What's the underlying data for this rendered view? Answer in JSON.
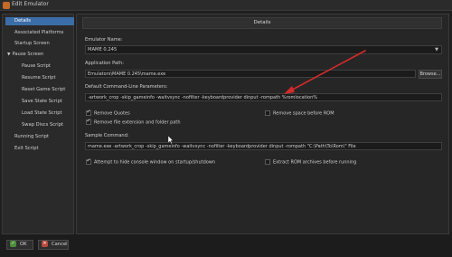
{
  "window": {
    "title": "Edit Emulator"
  },
  "sidebar": {
    "items": [
      {
        "label": "Details",
        "selected": true
      },
      {
        "label": "Associated Platforms"
      },
      {
        "label": "Startup Screen"
      },
      {
        "label": "Pause Screen",
        "expanded": true
      },
      {
        "label": "Pause Script"
      },
      {
        "label": "Resume Script"
      },
      {
        "label": "Reset Game Script"
      },
      {
        "label": "Save State Script"
      },
      {
        "label": "Load State Script"
      },
      {
        "label": "Swap Discs Script"
      },
      {
        "label": "Running Script"
      },
      {
        "label": "Exit Script"
      }
    ]
  },
  "panel": {
    "header": "Details",
    "emulator_name": {
      "label": "Emulator Name:",
      "value": "MAME 0.245"
    },
    "application_path": {
      "label": "Application Path:",
      "value": "Emulators\\MAME 0.245\\mame.exe",
      "browse_label": "Browse..."
    },
    "command_line": {
      "label": "Default Command-Line Parameters:",
      "value": "-artwork_crop -skip_gameinfo -waitvsync -nofilter -keyboardprovider dinput -rompath %romlocation%"
    },
    "checks": {
      "remove_quotes": {
        "label": "Remove Quotes",
        "checked": true
      },
      "remove_space": {
        "label": "Remove space before ROM",
        "checked": false
      },
      "remove_ext": {
        "label": "Remove file extension and folder path",
        "checked": true
      },
      "hide_console": {
        "label": "Attempt to hide console window on startup/shutdown",
        "checked": true
      },
      "extract_rom": {
        "label": "Extract ROM archives before running",
        "checked": false
      }
    },
    "sample_command": {
      "label": "Sample Command:",
      "value": "mame.exe -artwork_crop -skip_gameinfo -waitvsync -nofilter -keyboardprovider dinput -rompath \"C:\\Path\\To\\Rom\\\" File"
    }
  },
  "footer": {
    "ok_label": "OK",
    "cancel_label": "Cancel"
  },
  "colors": {
    "accent": "#3b6ea8",
    "annotation_arrow": "#d42a2a"
  }
}
